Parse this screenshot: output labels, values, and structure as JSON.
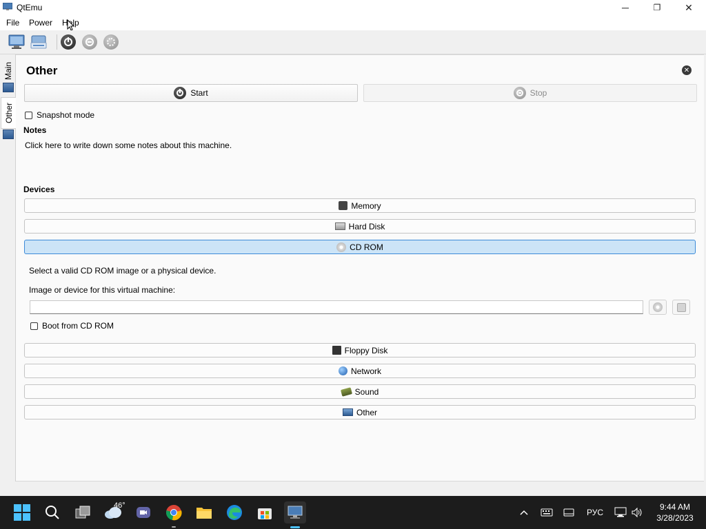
{
  "window": {
    "title": "QtEmu",
    "minimize": "─",
    "maximize": "❐",
    "close": "✕"
  },
  "menu": [
    "File",
    "Power",
    "Help"
  ],
  "side_tabs": [
    "Main",
    "Other"
  ],
  "panel": {
    "title": "Other",
    "start_label": "Start",
    "stop_label": "Stop",
    "snapshot_label": "Snapshot mode",
    "notes_heading": "Notes",
    "notes_text": "Click here to write down some notes about this machine.",
    "devices_heading": "Devices",
    "devices": {
      "memory": "Memory",
      "hard_disk": "Hard Disk",
      "cd_rom": "CD ROM",
      "floppy": "Floppy Disk",
      "network": "Network",
      "sound": "Sound",
      "other": "Other"
    },
    "cdrom": {
      "hint": "Select a valid CD ROM image or a physical device.",
      "image_label": "Image or device for this virtual machine:",
      "image_value": "",
      "boot_label": "Boot from CD ROM"
    }
  },
  "taskbar": {
    "weather_temp": "46°",
    "language": "РУС",
    "time": "9:44 AM",
    "date": "3/28/2023"
  },
  "colors": {
    "accent": "#cce4f7",
    "accent_border": "#3c8ad8",
    "taskbar": "#1c1c1c"
  }
}
